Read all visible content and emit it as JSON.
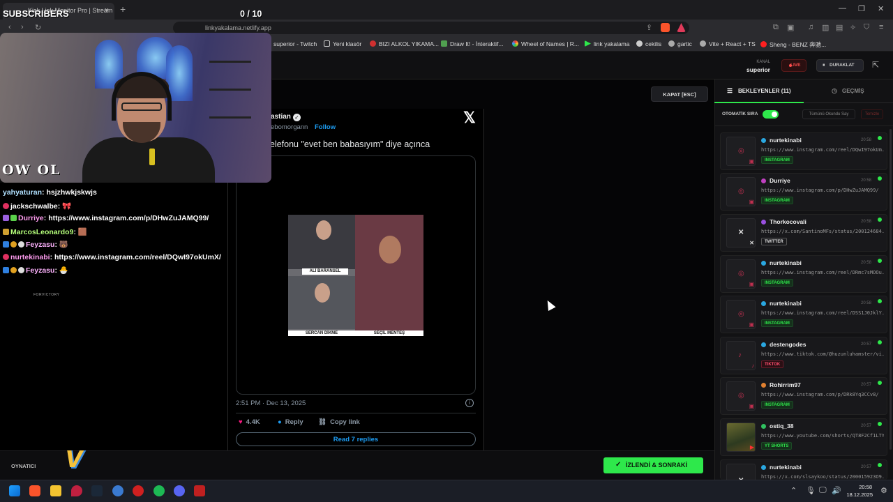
{
  "browser": {
    "tab_title": "Kick Link Monitor Pro | Stream",
    "tab_close": "×",
    "new_tab": "+",
    "url": "linkyakalama.netlify.app",
    "bookmarks": [
      "superior - Twitch",
      "Yeni klasör",
      "BIZI ALKOL YIKAMA...",
      "Draw It! - İnteraktif...",
      "Wheel of Names | R...",
      "link yakalama",
      "cekilis",
      "gartic",
      "Vite + React + TS",
      "Sheng - BENZ 奔驰..."
    ]
  },
  "overlay": {
    "subscribers_label": "SUBSCRIBERS",
    "subscribers_count": "0 / 10",
    "logo_text": "OW OL"
  },
  "app": {
    "kanal_label": "KANAL",
    "kanal_value": "superior",
    "live_label": "LIVE",
    "pause_label": "DURAKLAT",
    "close_label": "KAPAT [ESC]",
    "player_label": "OYNATICI",
    "next_button": "İZLENDİ & SONRAKİ",
    "colors": {
      "accent_green": "#2ee84b",
      "live_red": "#ff4d4d"
    }
  },
  "tweet": {
    "name": "astian",
    "handle": "ebomorgann",
    "follow": "Follow",
    "text": "elefonu \"evet ben babasıyım\" diye açınca",
    "video_labels": [
      "ALİ BARANSEL",
      "SERCAN DİKME",
      "SEÇİL MENTEŞ"
    ],
    "time": "2:51 PM · Dec 13, 2025",
    "likes": "4.4K",
    "reply": "Reply",
    "copy_link": "Copy link",
    "read_replies": "Read 7 replies"
  },
  "sidebar": {
    "tab_waiting": "BEKLEYENLER (11)",
    "tab_history": "GEÇMİŞ",
    "auto_queue_label": "OTOMATİK SIRA",
    "mark_all_read": "Tümünü Okundu Say",
    "clear": "Temizle",
    "queue": [
      {
        "user": "nurtekinabi",
        "time": "20:58",
        "url": "https://www.instagram.com/reel/DQwI97okUm...",
        "badge": "INSTAGRAM",
        "type": "ig",
        "dot": "#2aa7e0"
      },
      {
        "user": "Durriye",
        "time": "20:58",
        "url": "https://www.instagram.com/p/DHwZuJAMQ99/",
        "badge": "INSTAGRAM",
        "type": "ig",
        "dot": "#c040c0"
      },
      {
        "user": "Thorkocovali",
        "time": "20:58",
        "url": "https://x.com/SantinoMFs/status/200124684...",
        "badge": "TWITTER",
        "type": "tw",
        "dot": "#9a50e0"
      },
      {
        "user": "nurtekinabi",
        "time": "20:58",
        "url": "https://www.instagram.com/reel/DRmc7sMOOu...",
        "badge": "INSTAGRAM",
        "type": "ig",
        "dot": "#2aa7e0"
      },
      {
        "user": "nurtekinabi",
        "time": "20:58",
        "url": "https://www.instagram.com/reel/DSS1J0JklY...",
        "badge": "INSTAGRAM",
        "type": "ig",
        "dot": "#2aa7e0"
      },
      {
        "user": "destengodes",
        "time": "20:57",
        "url": "https://www.tiktok.com/@huzunluhamster/vi...",
        "badge": "TIKTOK",
        "type": "tt",
        "dot": "#2aa7e0"
      },
      {
        "user": "Rohirrim97",
        "time": "20:57",
        "url": "https://www.instagram.com/p/DRk8Yq3CCv8/",
        "badge": "INSTAGRAM",
        "type": "ig",
        "dot": "#e08030"
      },
      {
        "user": "ostiq_38",
        "time": "20:57",
        "url": "https://www.youtube.com/shorts/QT8F2Cf1LTY",
        "badge": "YT SHORTS",
        "type": "yt",
        "dot": "#30c060"
      },
      {
        "user": "nurtekinabi",
        "time": "20:57",
        "url": "https://x.com/slsaykoo/status/200015923O9...",
        "badge": "",
        "type": "tw",
        "dot": "#2aa7e0"
      }
    ]
  },
  "chat": [
    {
      "user": "yahyaturan",
      "msg": "hsjzhwkjskwjs",
      "color": "#b0e0ff"
    },
    {
      "user": "jackschwalbe",
      "msg": "🎀",
      "color": "#ffffff"
    },
    {
      "user": "Durriye",
      "msg": "https://www.instagram.com/p/DHwZuJAMQ99/",
      "color": "#ff9cf0"
    },
    {
      "user": "MarcosLeonardo9",
      "msg": "🟫",
      "color": "#b5ff7a"
    },
    {
      "user": "Feyzasu",
      "msg": "🐻",
      "color": "#ffb3ff"
    },
    {
      "user": "nurtekinabi",
      "msg": "https://www.instagram.com/reel/DQwI97okUmX/",
      "color": "#ff9cf0"
    },
    {
      "user": "Feyzasu",
      "msg": "🐣",
      "color": "#ffb3ff"
    }
  ],
  "chat_footer": "FORVICTORY",
  "taskbar": {
    "time": "20:58",
    "date": "18.12.2025"
  }
}
